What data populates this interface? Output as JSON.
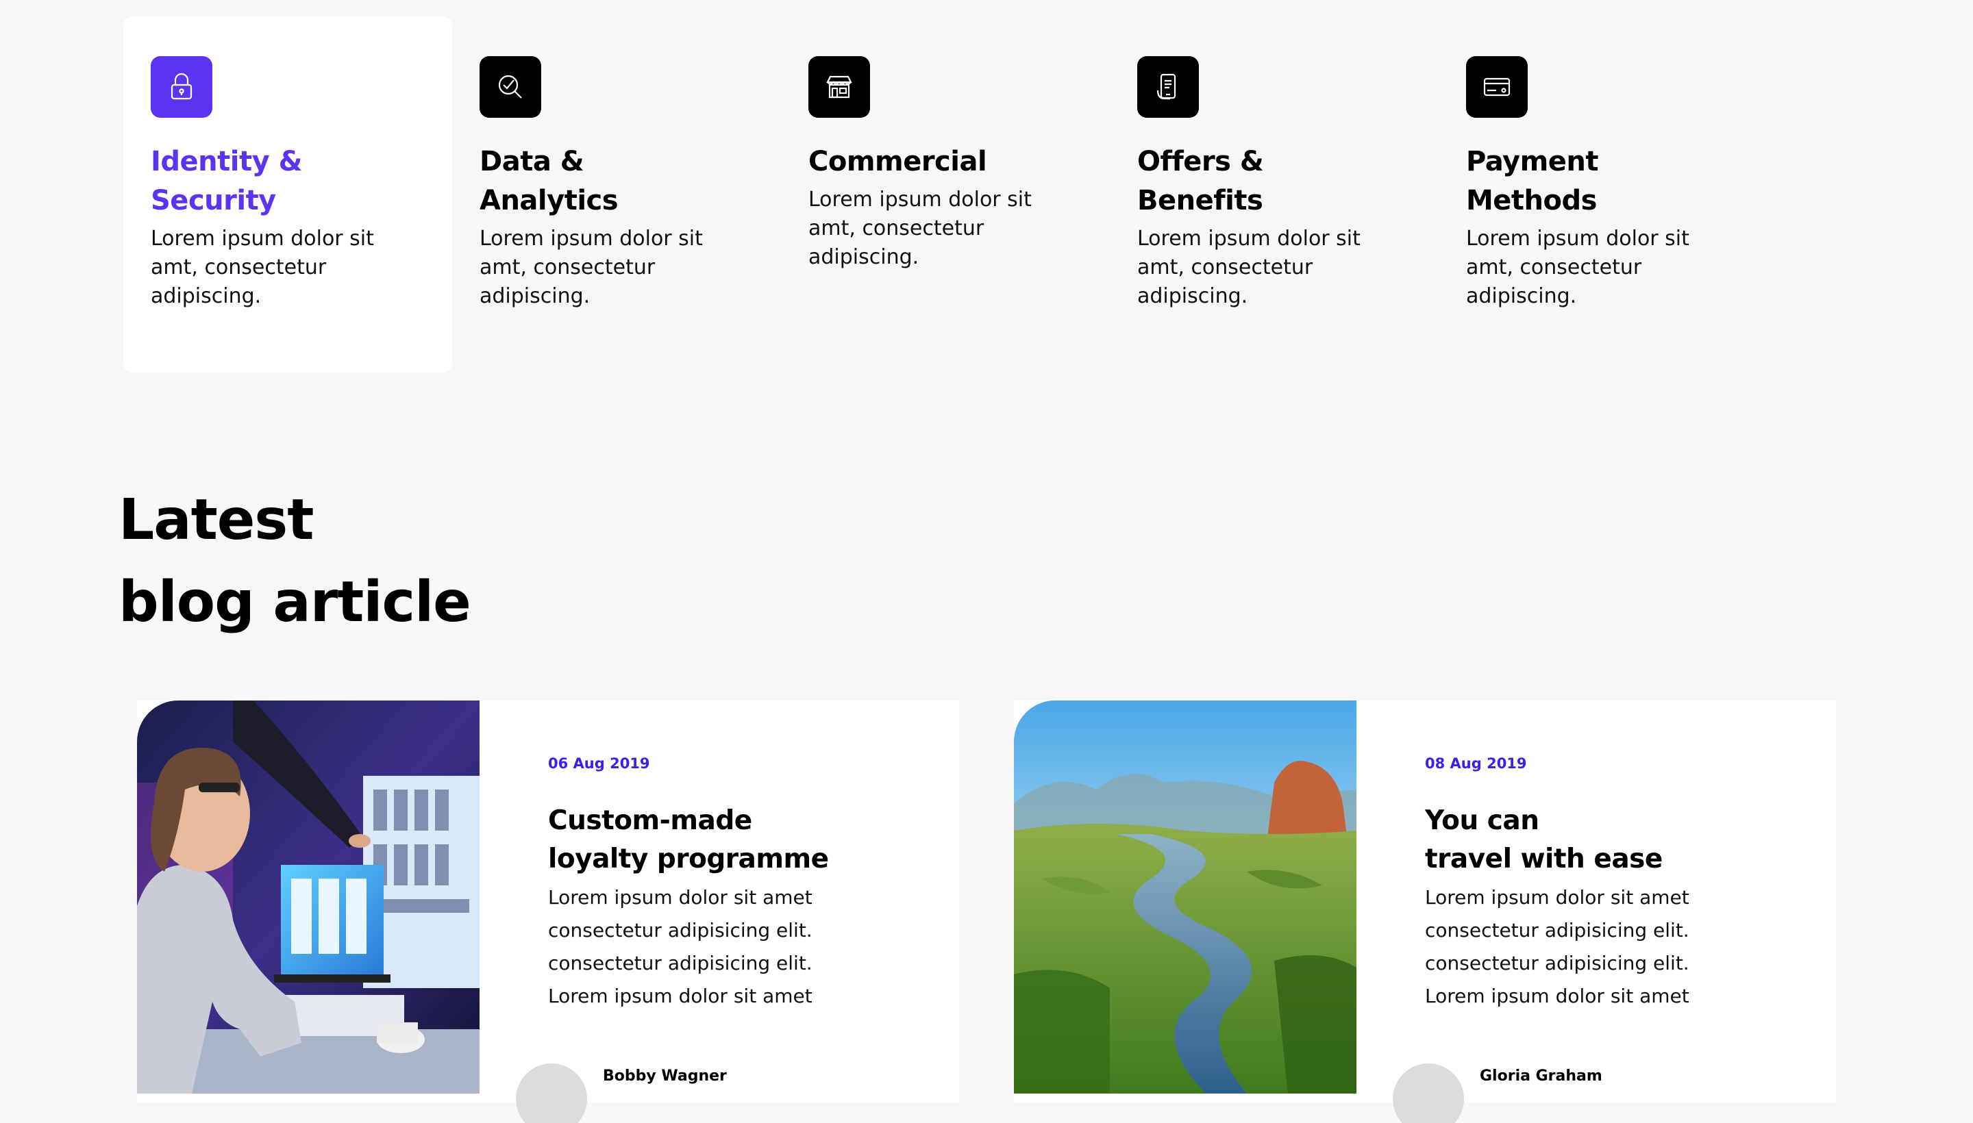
{
  "features": [
    {
      "title": "Identity &\nSecurity",
      "desc": "Lorem ipsum dolor sit amt, consectetur adipiscing.",
      "icon": "lock-icon",
      "active": true
    },
    {
      "title": "Data &\nAnalytics",
      "desc": "Lorem ipsum dolor sit amt, consectetur adipiscing.",
      "icon": "analytics-icon",
      "active": false
    },
    {
      "title": "Commercial",
      "desc": "Lorem ipsum dolor sit amt, consectetur adipiscing.",
      "icon": "store-icon",
      "active": false
    },
    {
      "title": "Offers &\nBenefits",
      "desc": "Lorem ipsum dolor sit amt, consectetur adipiscing.",
      "icon": "mobile-offer-icon",
      "active": false
    },
    {
      "title": "Payment\nMethods",
      "desc": "Lorem ipsum dolor sit amt, consectetur adipiscing.",
      "icon": "credit-card-icon",
      "active": false
    }
  ],
  "blog": {
    "heading": "Latest\nblog article",
    "articles": [
      {
        "date": "06 Aug 2019",
        "title": "Custom-made\nloyalty programme",
        "excerpt": "Lorem ipsum dolor sit amet\nconsectetur adipisicing elit.\nconsectetur adipisicing elit.\nLorem ipsum dolor sit amet",
        "author": "Bobby Wagner",
        "image": "woman-at-computer-photo"
      },
      {
        "date": "08 Aug 2019",
        "title": "You can\ntravel with ease",
        "excerpt": "Lorem ipsum dolor sit amet\nconsectetur adipisicing elit.\nconsectetur adipisicing elit.\nLorem ipsum dolor sit amet",
        "author": "Gloria Graham",
        "image": "river-landscape-photo"
      }
    ]
  },
  "colors": {
    "accent": "#5b34f2",
    "date": "#3b1ef0",
    "background": "#f7f7f9"
  }
}
